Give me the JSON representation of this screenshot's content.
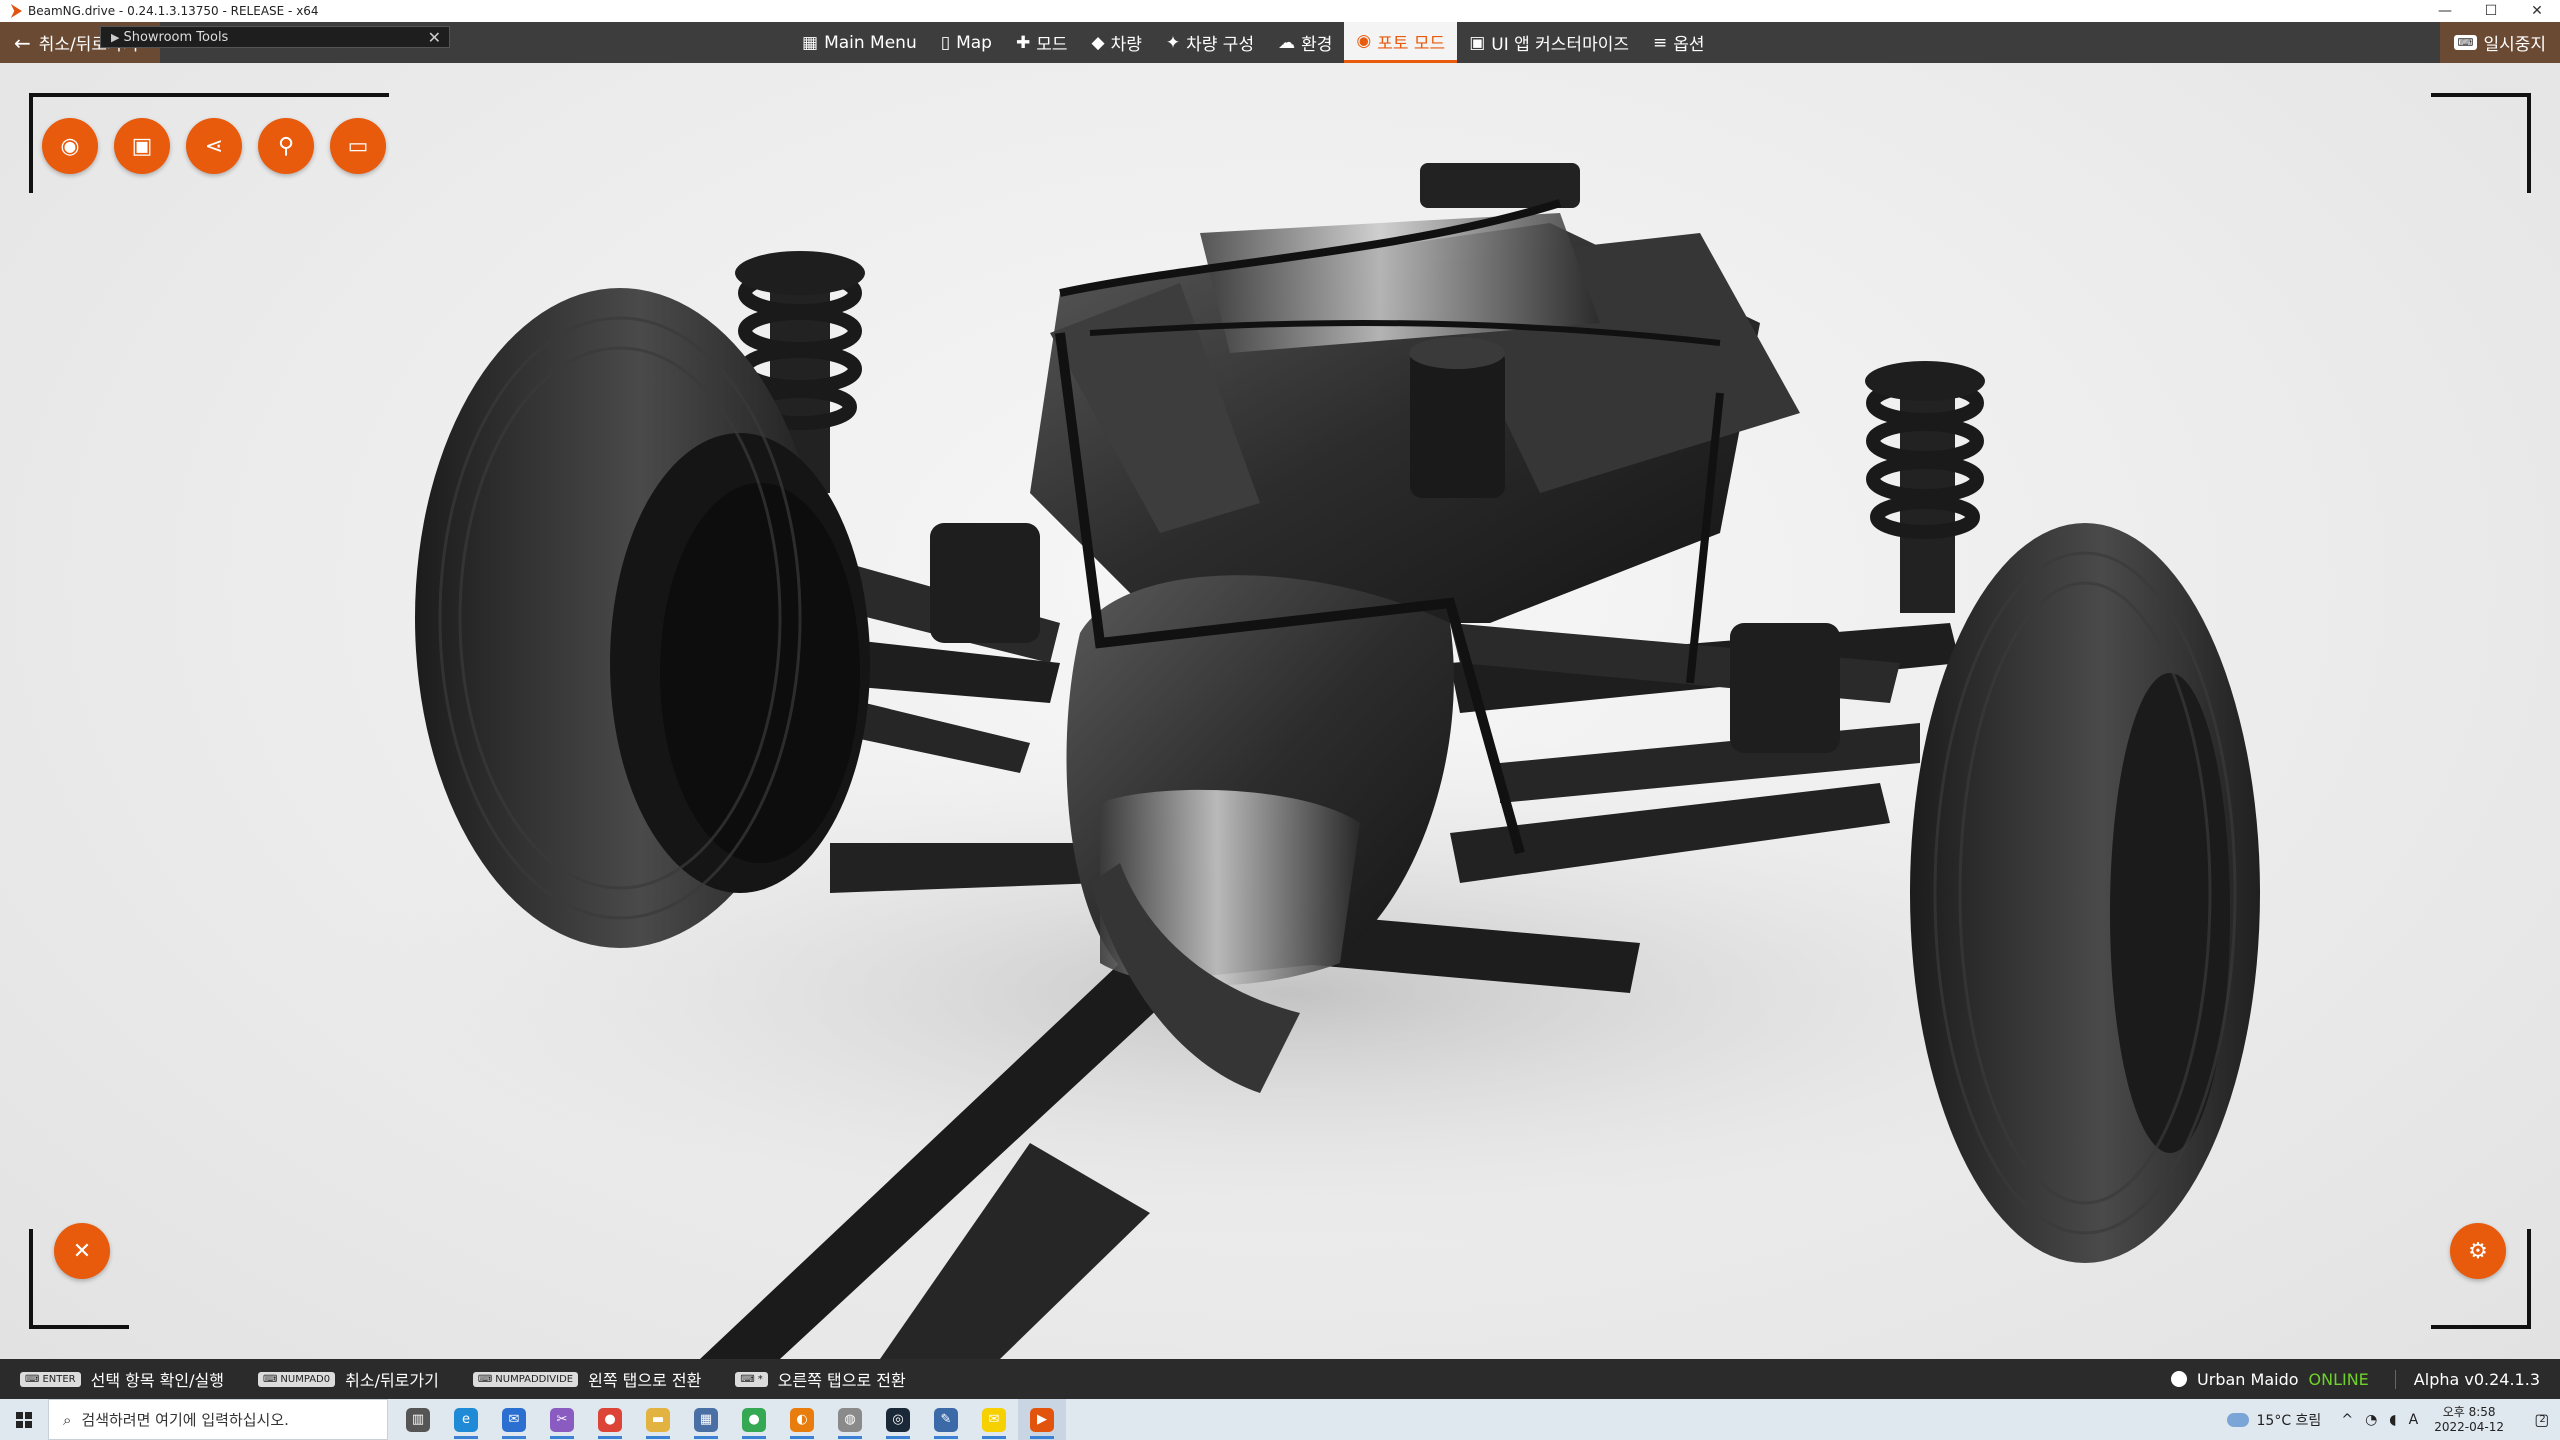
{
  "window": {
    "title": "BeamNG.drive - 0.24.1.3.13750 - RELEASE - x64",
    "minimize": "—",
    "maximize": "☐",
    "close": "✕"
  },
  "topbar": {
    "back_label": "취소/뒤로가기",
    "showroom_tip": "Showroom Tools",
    "menu": [
      {
        "label": "Main Menu",
        "icon": "▦"
      },
      {
        "label": "Map",
        "icon": "▯"
      },
      {
        "label": "모드",
        "icon": "✚"
      },
      {
        "label": "차량",
        "icon": "◆"
      },
      {
        "label": "차량 구성",
        "icon": "✦"
      },
      {
        "label": "환경",
        "icon": "☁"
      },
      {
        "label": "포토 모드",
        "icon": "◉"
      },
      {
        "label": "UI 앱 커스터마이즈",
        "icon": "▣"
      },
      {
        "label": "옵션",
        "icon": "≡"
      }
    ],
    "active_index": 6,
    "pause_label": "일시중지",
    "pause_key": "⌨"
  },
  "photo_tools": {
    "buttons": [
      "camera-icon",
      "image-icon",
      "share-icon",
      "steam-icon",
      "folder-icon"
    ],
    "glyphs": [
      "◉",
      "▣",
      "⋖",
      "⚲",
      "▭"
    ],
    "close_glyph": "✕",
    "settings_glyph": "⚙"
  },
  "hints": [
    {
      "key": "ENTER",
      "label": "선택 항목 확인/실행"
    },
    {
      "key": "NUMPAD0",
      "label": "취소/뒤로가기"
    },
    {
      "key": "NUMPADDIVIDE",
      "label": "왼쪽 탭으로 전환"
    },
    {
      "key": "*",
      "label": "오른쪽 탭으로 전환"
    }
  ],
  "status": {
    "user": "Urban Maido",
    "online": "ONLINE",
    "version": "Alpha v0.24.1.3"
  },
  "taskbar": {
    "search_placeholder": "검색하려면 여기에 입력하십시오.",
    "apps": [
      {
        "name": "task-view",
        "color": "#555555",
        "glyph": "▥"
      },
      {
        "name": "edge",
        "color": "#1f8ad6",
        "glyph": "e"
      },
      {
        "name": "mail",
        "color": "#2b6fd0",
        "glyph": "✉"
      },
      {
        "name": "snip",
        "color": "#8a5cc2",
        "glyph": "✂"
      },
      {
        "name": "chrome",
        "color": "#db4437",
        "glyph": "●"
      },
      {
        "name": "explorer",
        "color": "#e3b341",
        "glyph": "▬"
      },
      {
        "name": "calculator",
        "color": "#4a6fa5",
        "glyph": "▦"
      },
      {
        "name": "chrome-2",
        "color": "#34a853",
        "glyph": "●"
      },
      {
        "name": "blender",
        "color": "#e87d0d",
        "glyph": "◐"
      },
      {
        "name": "app-grey",
        "color": "#8a8a8a",
        "glyph": "◍"
      },
      {
        "name": "steam",
        "color": "#1b2838",
        "glyph": "◎"
      },
      {
        "name": "notepad",
        "color": "#3c6aa8",
        "glyph": "✎"
      },
      {
        "name": "kakaotalk",
        "color": "#f7d000",
        "glyph": "✉"
      },
      {
        "name": "beamng",
        "color": "#e2540e",
        "glyph": "▶"
      }
    ],
    "weather": "15°C 흐림",
    "ime": "A",
    "time": "오후 8:58",
    "date": "2022-04-12",
    "notifications": "2"
  }
}
